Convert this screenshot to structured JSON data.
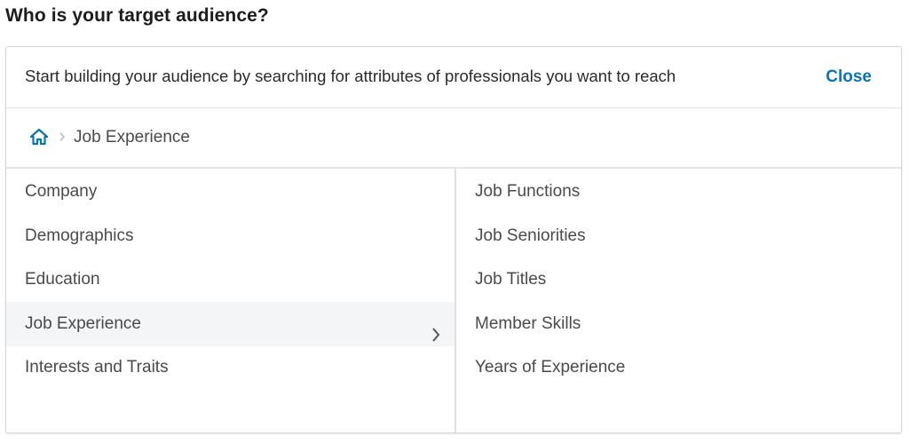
{
  "page": {
    "heading": "Who is your target audience?"
  },
  "panel": {
    "intro_text": "Start building your audience by searching for attributes of professionals you want to reach",
    "close_label": "Close"
  },
  "breadcrumb": {
    "home_icon": "home-icon",
    "current": "Job Experience"
  },
  "categories": [
    {
      "label": "Company"
    },
    {
      "label": "Demographics"
    },
    {
      "label": "Education"
    },
    {
      "label": "Job Experience",
      "selected": true
    },
    {
      "label": "Interests and Traits"
    }
  ],
  "subcategories": [
    {
      "label": "Job Functions"
    },
    {
      "label": "Job Seniorities"
    },
    {
      "label": "Job Titles"
    },
    {
      "label": "Member Skills"
    },
    {
      "label": "Years of Experience"
    }
  ],
  "colors": {
    "accent": "#0a74b6",
    "selected_bg": "#f3f5f7",
    "border": "#d6d6d6"
  }
}
